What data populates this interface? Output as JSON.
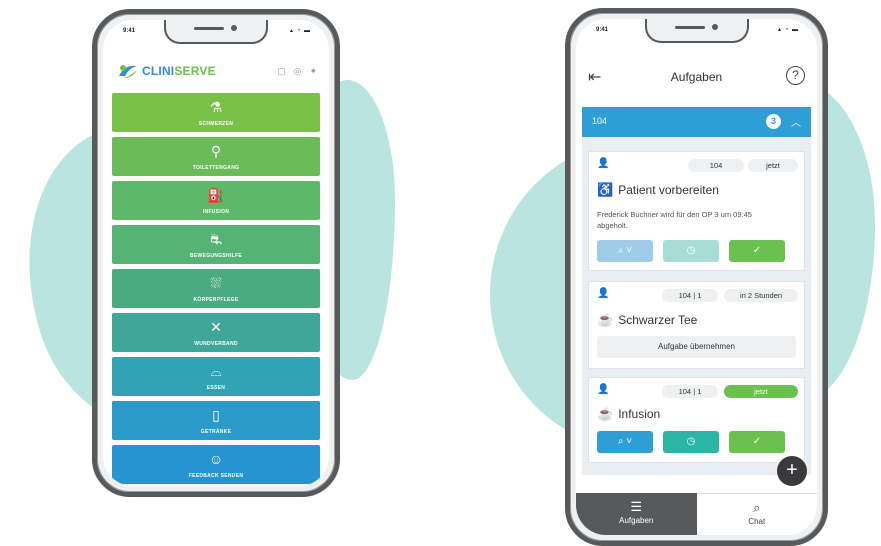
{
  "phone1": {
    "status_time": "9:41",
    "status_icons": "▴ ◔ ▬",
    "logo_clini": "CLINI",
    "logo_serve": "SERVE",
    "top_icons": [
      "▢",
      "◎",
      "✦"
    ],
    "tiles": [
      {
        "label": "SCHMERZEN",
        "icon": "pills-icon",
        "glyph": "⚗",
        "color": "#7ac14a"
      },
      {
        "label": "TOILETTENGANG",
        "icon": "toilet-icon",
        "glyph": "⚲",
        "color": "#6cbb5a"
      },
      {
        "label": "INFUSION",
        "icon": "infusion-icon",
        "glyph": "⛽",
        "color": "#5db868"
      },
      {
        "label": "BEWEGUNGSHILFE",
        "icon": "bed-patient-icon",
        "glyph": "⛐",
        "color": "#55b373"
      },
      {
        "label": "KÖRPERPFLEGE",
        "icon": "shower-icon",
        "glyph": "⛆",
        "color": "#4aab80"
      },
      {
        "label": "WUNDVERBAND",
        "icon": "bandage-icon",
        "glyph": "✕",
        "color": "#3ea79a"
      },
      {
        "label": "ESSEN",
        "icon": "cloche-icon",
        "glyph": "⌓",
        "color": "#31a3b5"
      },
      {
        "label": "GETRÄNKE",
        "icon": "glass-icon",
        "glyph": "▯",
        "color": "#2a9bc8"
      },
      {
        "label": "FEEDBACK SENDEN",
        "icon": "feedback-icon",
        "glyph": "☺",
        "color": "#2594cf"
      }
    ]
  },
  "phone2": {
    "status_time": "9:41",
    "status_icons": "▴ ◔ ▬",
    "header_title": "Aufgaben",
    "help_glyph": "?",
    "exit_glyph": "⇤",
    "room": {
      "number": "104",
      "count": "3",
      "chevron": "︿"
    },
    "cards": [
      {
        "room_pill": "104",
        "time_pill": "jetzt",
        "title": "Patient vorbereiten",
        "title_glyph": "♿",
        "desc": "Frederick Buchner wird für den OP 3 um 09:45 abgeholt."
      },
      {
        "room_pill": "104 | 1",
        "time_pill": "in 2 Stunden",
        "title": "Schwarzer Tee",
        "title_glyph": "☕",
        "action": "Aufgabe übernehmen"
      },
      {
        "room_pill": "104 | 1",
        "time_pill": "jetzt",
        "title": "Infusion",
        "title_glyph": "☕"
      }
    ],
    "btn_glyphs": {
      "chat": "⌕ ˅",
      "clock": "◷",
      "check": "✓"
    },
    "fab": "+",
    "tabs": [
      {
        "label": "Aufgaben",
        "glyph": "☰"
      },
      {
        "label": "Chat",
        "glyph": "⌕"
      }
    ],
    "colors": {
      "green": "#6ac14e",
      "blue": "#2e9fd6",
      "teal": "#2bb5a5",
      "light_blue": "#9fcde9",
      "light_teal": "#a8ddd6"
    }
  }
}
